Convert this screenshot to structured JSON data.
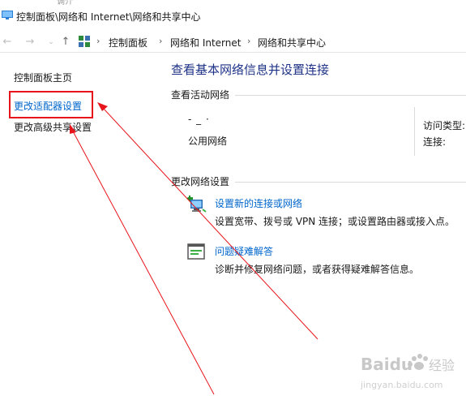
{
  "window": {
    "tab_remnant": "调介",
    "title": "控制面板\\网络和 Internet\\网络和共享中心"
  },
  "address_bar": {
    "back_icon": "back-arrow-icon",
    "forward_icon": "forward-arrow-icon",
    "up_icon": "up-arrow-icon",
    "crumbs": [
      "控制面板",
      "网络和 Internet",
      "网络和共享中心"
    ]
  },
  "sidebar": {
    "home": "控制面板主页",
    "adapter": "更改适配器设置",
    "sharing": "更改高级共享设置"
  },
  "main": {
    "heading": "查看基本网络信息并设置连接",
    "active_label": "查看活动网络",
    "network_name": "-  _  ·",
    "network_type": "公用网络",
    "access_type_label": "访问类型:",
    "connection_label": "连接:",
    "change_label": "更改网络设置",
    "tasks": [
      {
        "title": "设置新的连接或网络",
        "desc": "设置宽带、拨号或 VPN 连接；或设置路由器或接入点。"
      },
      {
        "title": "问题疑难解答",
        "desc": "诊断并修复网络问题，或者获得疑难解答信息。"
      }
    ]
  },
  "watermark": {
    "brand": "Baidu",
    "suffix": "经验",
    "url": "jingyan.baidu.com"
  },
  "colors": {
    "link": "#0066cc",
    "heading": "#1e3287",
    "annotation_red": "#e8141b",
    "rule": "#dadada"
  }
}
